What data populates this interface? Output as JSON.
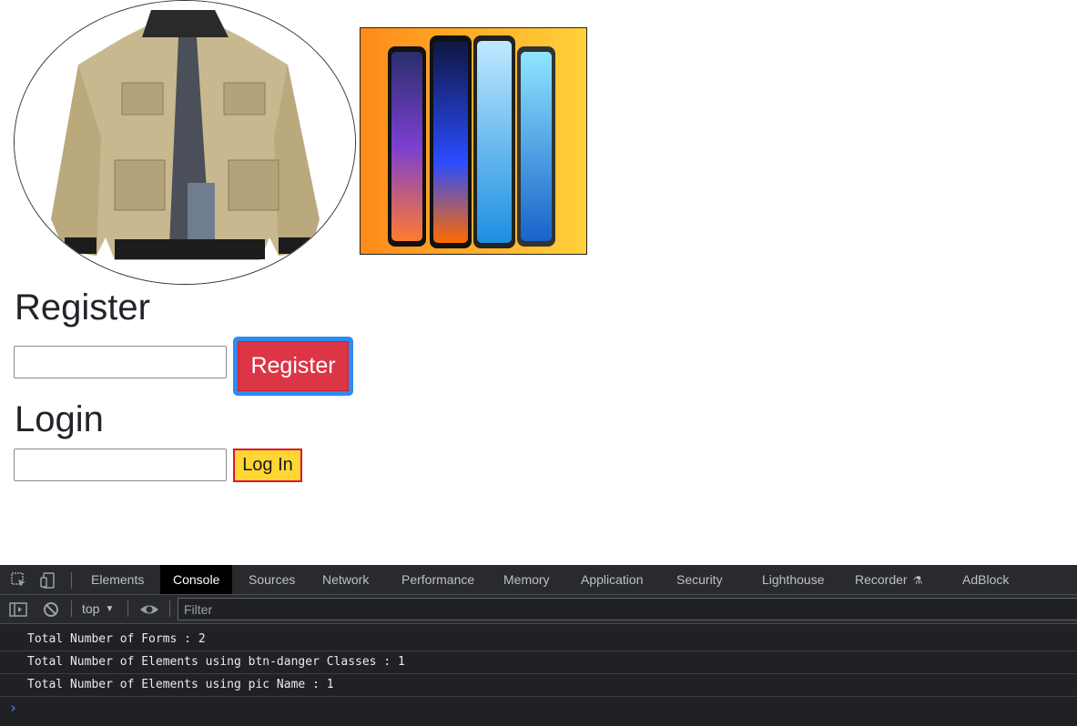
{
  "page": {
    "images": {
      "jacket": "product image: beige jacket",
      "phones": "product image: smartphones"
    },
    "register": {
      "heading": "Register",
      "input_value": "",
      "button_label": "Register"
    },
    "login": {
      "heading": "Login",
      "input_value": "",
      "button_label": "Log In"
    }
  },
  "devtools": {
    "tabs": [
      {
        "label": "Elements",
        "active": false
      },
      {
        "label": "Console",
        "active": true
      },
      {
        "label": "Sources",
        "active": false
      },
      {
        "label": "Network",
        "active": false
      },
      {
        "label": "Performance",
        "active": false
      },
      {
        "label": "Memory",
        "active": false
      },
      {
        "label": "Application",
        "active": false
      },
      {
        "label": "Security",
        "active": false
      },
      {
        "label": "Lighthouse",
        "active": false
      },
      {
        "label": "Recorder",
        "active": false
      },
      {
        "label": "AdBlock",
        "active": false
      }
    ],
    "toolbar": {
      "context": "top",
      "filter_placeholder": "Filter"
    },
    "console_lines": [
      "Total Number of Forms : 2",
      "Total Number of Elements using btn-danger Classes : 1",
      "Total Number of Elements using pic Name : 1"
    ],
    "prompt_symbol": "›"
  },
  "colors": {
    "register_button": "#dc3545",
    "register_button_border": "#2e8cf0",
    "login_button": "#ffd633",
    "login_button_border": "#e0152f",
    "devtools_bg": "#202124"
  }
}
